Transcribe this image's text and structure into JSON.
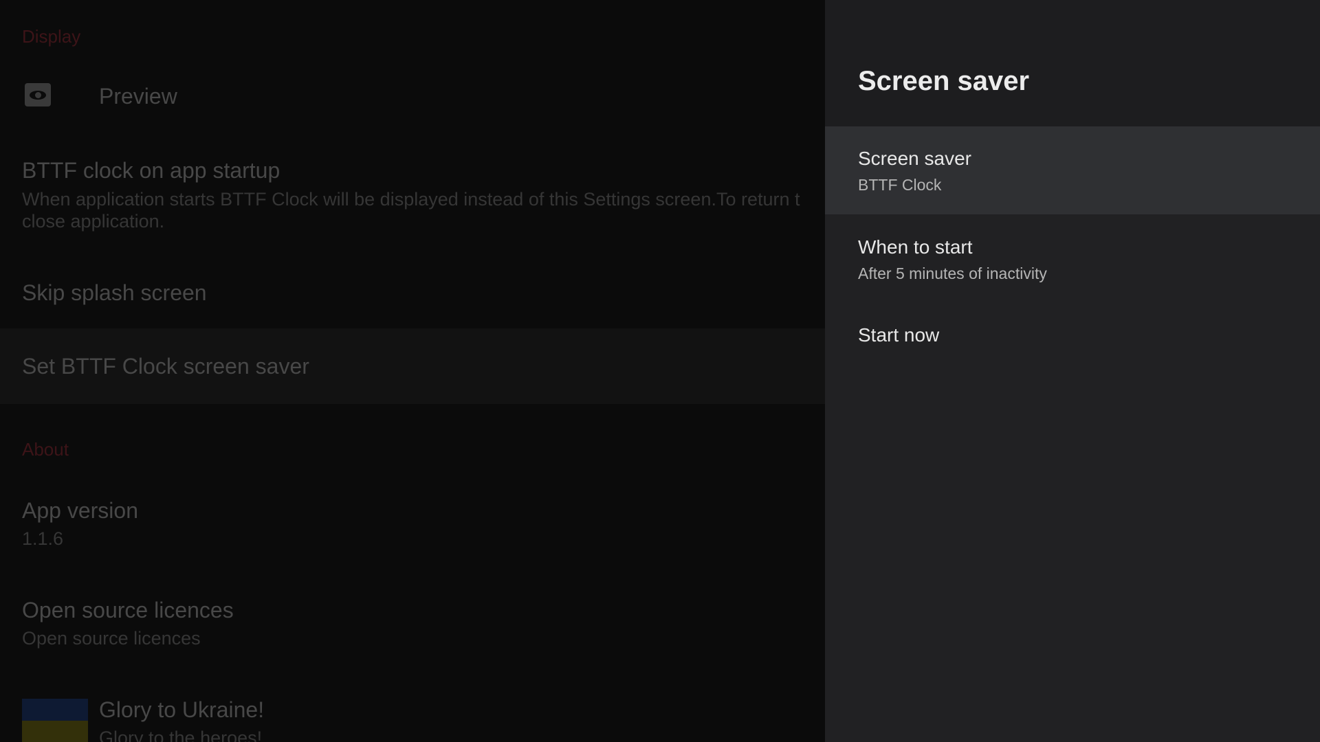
{
  "background": {
    "display_category": "Display",
    "preview_label": "Preview",
    "bttf_startup_title": "BTTF clock on app startup",
    "bttf_startup_summary_line1": "When application starts BTTF Clock will be displayed instead of this Settings screen.To return t",
    "bttf_startup_summary_line2": "close application.",
    "skip_splash_title": "Skip splash screen",
    "set_screensaver_title": "Set BTTF Clock screen saver",
    "about_category": "About",
    "app_version_title": "App version",
    "app_version_value": "1.1.6",
    "licences_title": "Open source licences",
    "licences_summary": "Open source licences",
    "ukraine_title": "Glory to Ukraine!",
    "ukraine_summary": "Glory to the heroes!"
  },
  "panel": {
    "title": "Screen saver",
    "items": [
      {
        "title": "Screen saver",
        "summary": "BTTF Clock"
      },
      {
        "title": "When to start",
        "summary": "After 5 minutes of inactivity"
      },
      {
        "title": "Start now"
      }
    ]
  },
  "colors": {
    "accent": "#3d1418",
    "panel_background": "#212123",
    "focused_item": "#2f3033"
  }
}
